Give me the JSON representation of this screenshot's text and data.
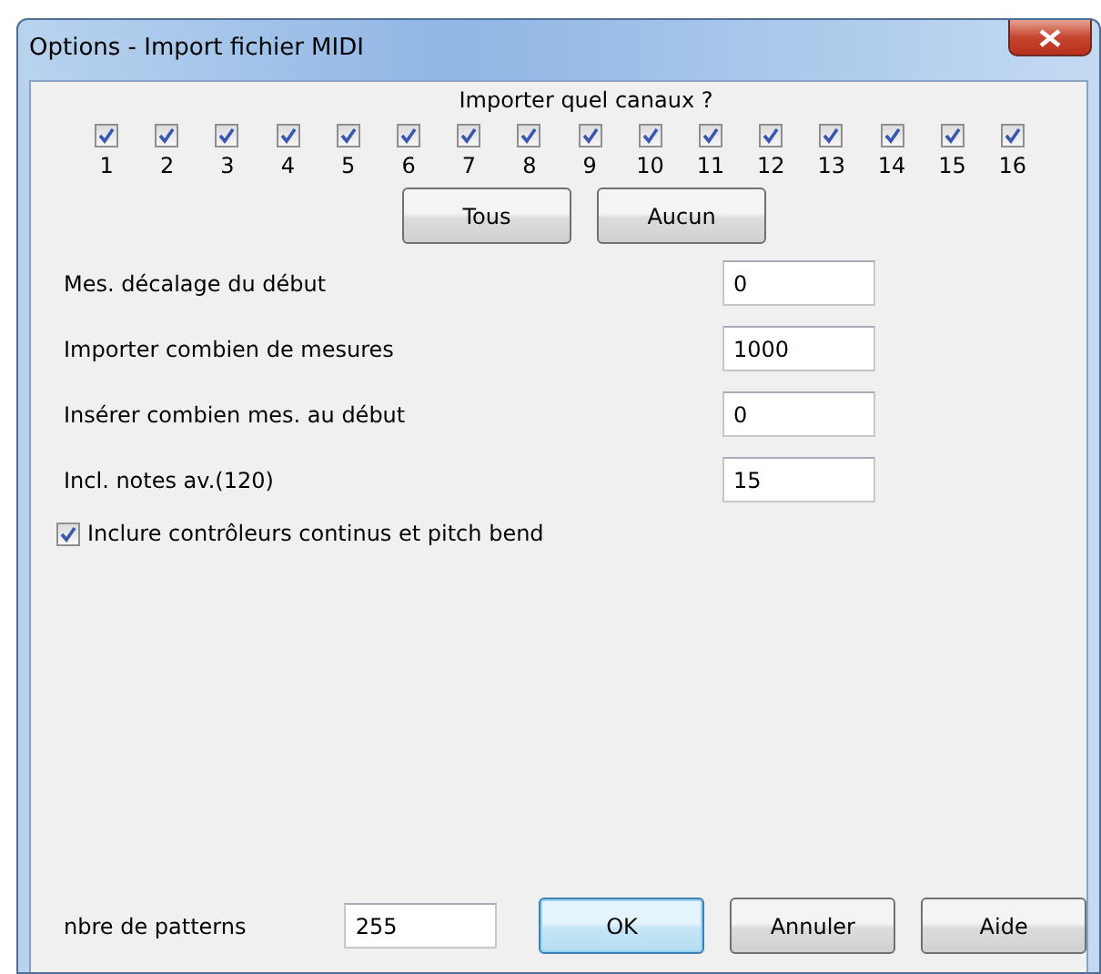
{
  "window": {
    "title": "Options - Import fichier MIDI"
  },
  "channels": {
    "heading": "Importer quel canaux ?",
    "items": [
      {
        "label": "1",
        "checked": true
      },
      {
        "label": "2",
        "checked": true
      },
      {
        "label": "3",
        "checked": true
      },
      {
        "label": "4",
        "checked": true
      },
      {
        "label": "5",
        "checked": true
      },
      {
        "label": "6",
        "checked": true
      },
      {
        "label": "7",
        "checked": true
      },
      {
        "label": "8",
        "checked": true
      },
      {
        "label": "9",
        "checked": true
      },
      {
        "label": "10",
        "checked": true
      },
      {
        "label": "11",
        "checked": true
      },
      {
        "label": "12",
        "checked": true
      },
      {
        "label": "13",
        "checked": true
      },
      {
        "label": "14",
        "checked": true
      },
      {
        "label": "15",
        "checked": true
      },
      {
        "label": "16",
        "checked": true
      }
    ],
    "buttons": [
      "Tous",
      "Aucun"
    ]
  },
  "fields": [
    {
      "label": "Mes. décalage du début",
      "value": "0"
    },
    {
      "label": "Importer combien de mesures",
      "value": "1000"
    },
    {
      "label": "Insérer combien mes. au début",
      "value": "0"
    },
    {
      "label": "Incl. notes av.(120)",
      "value": "15"
    }
  ],
  "include_controllers": {
    "label": "Inclure contrôleurs continus et pitch bend",
    "checked": true
  },
  "patterns": {
    "label": "nbre de patterns",
    "value": "255"
  },
  "buttons": [
    {
      "label": "OK",
      "selected": true
    },
    {
      "label": "Annuler",
      "selected": false
    },
    {
      "label": "Aide",
      "selected": false
    }
  ]
}
